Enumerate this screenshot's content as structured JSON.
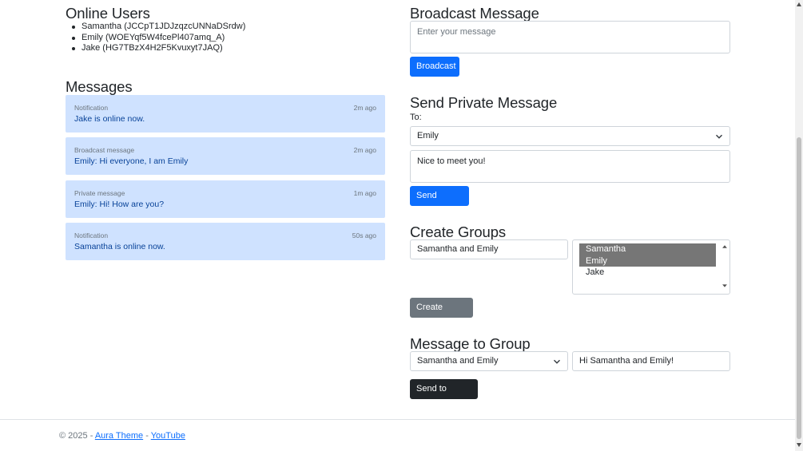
{
  "online_users": {
    "title": "Online Users",
    "users": [
      "Samantha (JCCpT1JDJzqzcUNNaDSrdw)",
      "Emily (WOEYqf5W4fcePl407amq_A)",
      "Jake (HG7TBzX4H2F5Kvuxyt7JAQ)"
    ]
  },
  "messages": {
    "title": "Messages",
    "items": [
      {
        "type": "Notification",
        "time": "2m ago",
        "text": "Jake is online now."
      },
      {
        "type": "Broadcast message",
        "time": "2m ago",
        "text": "Emily: Hi everyone, I am Emily"
      },
      {
        "type": "Private message",
        "time": "1m ago",
        "text": "Emily: Hi! How are you?"
      },
      {
        "type": "Notification",
        "time": "50s ago",
        "text": "Samantha is online now."
      }
    ]
  },
  "broadcast": {
    "title": "Broadcast Message",
    "placeholder": "Enter your message",
    "value": "",
    "button": "Broadcast"
  },
  "private": {
    "title": "Send Private Message",
    "to_label": "To:",
    "recipient": "Emily",
    "message": "Nice to meet you!",
    "button": "Send Private"
  },
  "groups": {
    "title": "Create Groups",
    "group_name": "Samantha and Emily",
    "members": [
      {
        "name": "Samantha",
        "selected": true
      },
      {
        "name": "Emily",
        "selected": true
      },
      {
        "name": "Jake",
        "selected": false
      }
    ],
    "button": "Create Group"
  },
  "group_message": {
    "title": "Message to Group",
    "group": "Samantha and Emily",
    "message": "Hi Samantha and Emily!",
    "button": "Send to Group"
  },
  "footer": {
    "copyright": "© 2025 -",
    "link1": "Aura Theme",
    "separator": "-",
    "link2": "YouTube"
  },
  "colors": {
    "primary": "#0d6efd",
    "secondary": "#6c757d",
    "dark": "#212529",
    "message_bg": "#cfe2ff",
    "message_text": "#084298"
  }
}
